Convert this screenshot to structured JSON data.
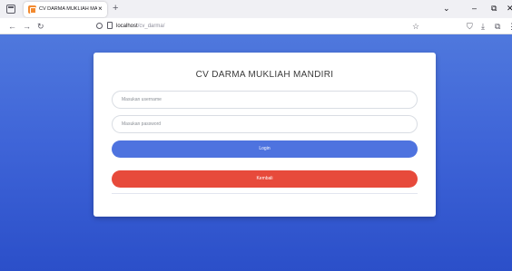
{
  "browser": {
    "tab_title": "CV DARMA MUKLIAH MANDIRI",
    "tab_close": "×",
    "new_tab": "+",
    "url_host": "localhost",
    "url_path": "/cv_darma/",
    "icons": [
      "tab-overview-icon",
      "favicon-icon",
      "close-icon",
      "new-tab-icon",
      "chevron-down-icon",
      "minimize-icon",
      "restore-icon",
      "close-window-icon",
      "back-icon",
      "forward-icon",
      "reload-icon",
      "shield-icon",
      "page-icon",
      "star-icon",
      "pocket-icon",
      "download-icon",
      "extensions-icon",
      "menu-icon"
    ]
  },
  "login": {
    "title": "CV DARMA MUKLIAH MANDIRI",
    "username_placeholder": "Masukan username",
    "password_placeholder": "Masukan password",
    "login_label": "Login",
    "back_label": "Kembali"
  },
  "colors": {
    "background_top": "#4f78dd",
    "background_bottom": "#2b4fc9",
    "login_button": "#4e73df",
    "back_button": "#e74a3b",
    "tab_favicon": "#f28a30"
  }
}
